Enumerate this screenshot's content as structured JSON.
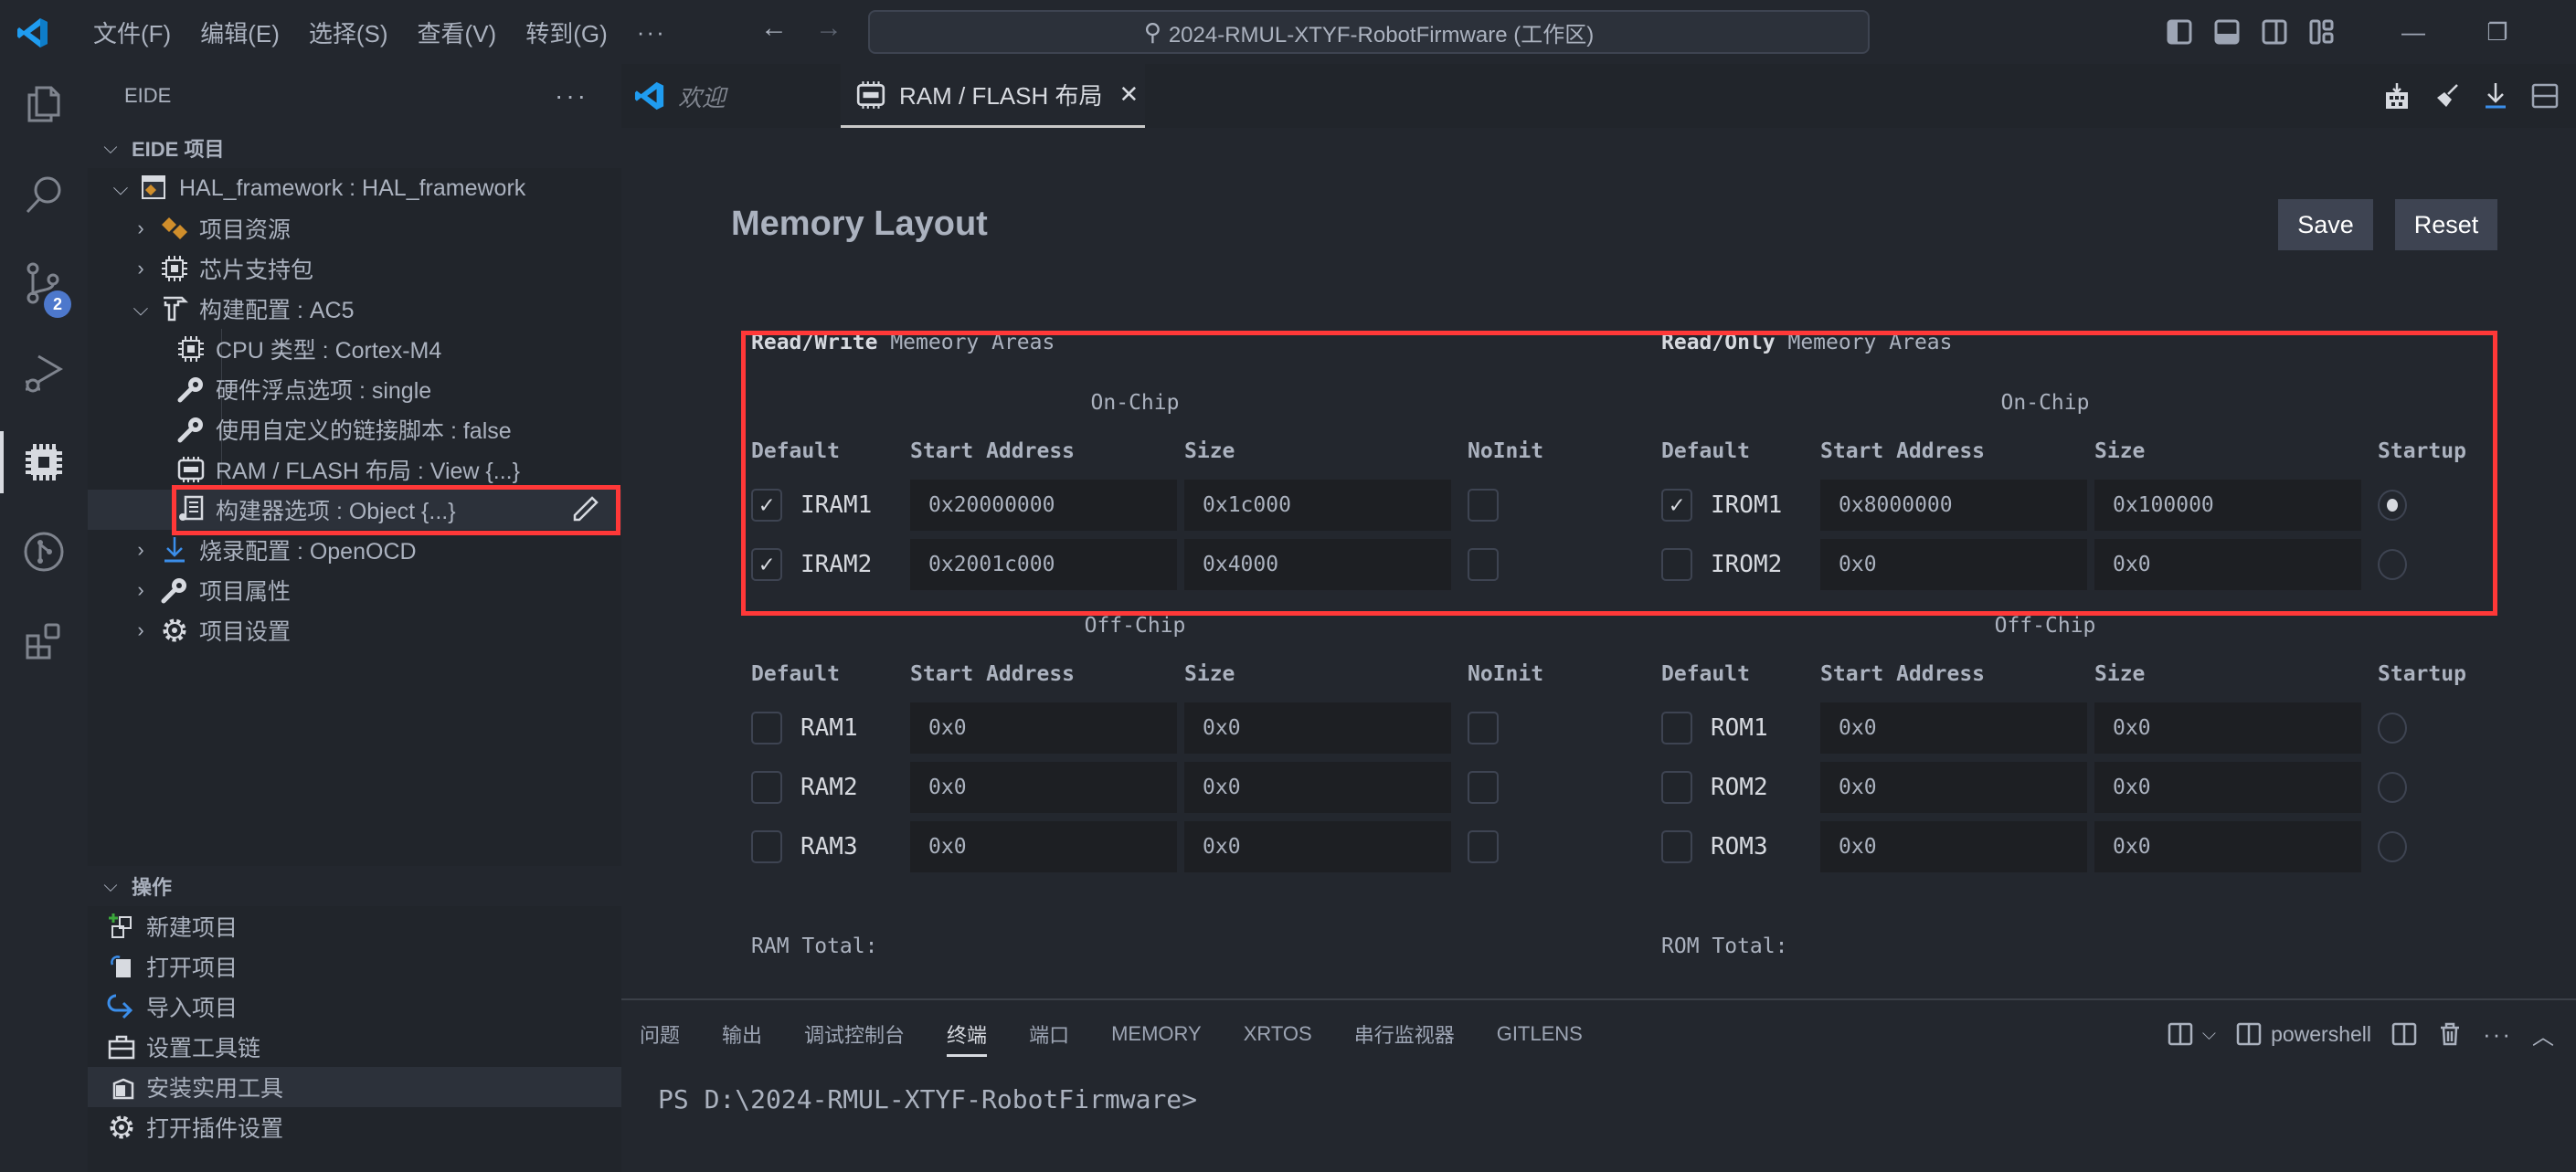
{
  "titlebar": {
    "menu": [
      "文件(F)",
      "编辑(E)",
      "选择(S)",
      "查看(V)",
      "转到(G)",
      "···"
    ],
    "command_center": "2024-RMUL-XTYF-RobotFirmware (工作区)",
    "icons": [
      "toggle-primary-sidebar-icon",
      "toggle-panel-icon",
      "toggle-secondary-sidebar-icon",
      "customize-layout-icon"
    ],
    "window_controls": {
      "minimize": "—",
      "restore": "❐"
    }
  },
  "activity_bar": {
    "items": [
      "explorer",
      "search",
      "source-control",
      "run-debug",
      "eide",
      "git-graph",
      "extensions"
    ],
    "source_control_badge": "2",
    "active": "eide"
  },
  "sidebar": {
    "title": "EIDE",
    "more": "···",
    "project_section": "EIDE 项目",
    "tree": [
      {
        "label": "HAL_framework : HAL_framework",
        "level": 0,
        "expanded": true,
        "icon": "project-icon"
      },
      {
        "label": "项目资源",
        "level": 1,
        "expanded": false,
        "icon": "resources-icon"
      },
      {
        "label": "芯片支持包",
        "level": 1,
        "expanded": false,
        "icon": "chip-icon"
      },
      {
        "label": "构建配置 : AC5",
        "level": 1,
        "expanded": true,
        "icon": "hammer-icon"
      },
      {
        "label": "CPU 类型 : Cortex-M4",
        "level": 2,
        "icon": "cpu-icon"
      },
      {
        "label": "硬件浮点选项 : single",
        "level": 2,
        "icon": "wrench-icon"
      },
      {
        "label": "使用自定义的链接脚本 : false",
        "level": 2,
        "icon": "wrench-icon"
      },
      {
        "label": "RAM / FLASH 布局 : View {...}",
        "level": 2,
        "icon": "memory-icon"
      },
      {
        "label": "构建器选项 : Object {...}",
        "level": 2,
        "icon": "builder-options-icon",
        "selected": true
      },
      {
        "label": "烧录配置 : OpenOCD",
        "level": 1,
        "expanded": false,
        "icon": "flash-download-icon"
      },
      {
        "label": "项目属性",
        "level": 1,
        "expanded": false,
        "icon": "wrench-icon"
      },
      {
        "label": "项目设置",
        "level": 1,
        "expanded": false,
        "icon": "gear-icon"
      }
    ],
    "ops_section": "操作",
    "ops": [
      {
        "label": "新建项目",
        "icon": "new-project-icon"
      },
      {
        "label": "打开项目",
        "icon": "open-project-icon"
      },
      {
        "label": "导入项目",
        "icon": "import-project-icon"
      },
      {
        "label": "设置工具链",
        "icon": "toolbox-icon"
      },
      {
        "label": "安装实用工具",
        "icon": "install-tool-icon",
        "selected": true
      },
      {
        "label": "打开插件设置",
        "icon": "gear-icon"
      }
    ]
  },
  "editor": {
    "tabs": [
      {
        "label": "欢迎",
        "active": false
      },
      {
        "label": "RAM / FLASH 布局",
        "active": true,
        "close": "✕"
      }
    ],
    "title": "Memory Layout",
    "save_label": "Save",
    "reset_label": "Reset",
    "rw": {
      "title_bold": "Read/Write",
      "title_rest": " Memeory Areas",
      "on_chip_title": "On-Chip",
      "off_chip_title": "Off-Chip",
      "columns": [
        "Default",
        "Start Address",
        "Size",
        "NoInit"
      ],
      "on_chip": [
        {
          "name": "IRAM1",
          "default": true,
          "start": "0x20000000",
          "size": "0x1c000",
          "noinit": false
        },
        {
          "name": "IRAM2",
          "default": true,
          "start": "0x2001c000",
          "size": "0x4000",
          "noinit": false
        }
      ],
      "off_chip": [
        {
          "name": "RAM1",
          "default": false,
          "start": "0x0",
          "size": "0x0",
          "noinit": false
        },
        {
          "name": "RAM2",
          "default": false,
          "start": "0x0",
          "size": "0x0",
          "noinit": false
        },
        {
          "name": "RAM3",
          "default": false,
          "start": "0x0",
          "size": "0x0",
          "noinit": false
        }
      ],
      "total_label": "RAM Total:"
    },
    "ro": {
      "title_bold": "Read/Only",
      "title_rest": " Memeory Areas",
      "on_chip_title": "On-Chip",
      "off_chip_title": "Off-Chip",
      "columns": [
        "Default",
        "Start Address",
        "Size",
        "Startup"
      ],
      "on_chip": [
        {
          "name": "IROM1",
          "default": true,
          "start": "0x8000000",
          "size": "0x100000",
          "startup": true
        },
        {
          "name": "IROM2",
          "default": false,
          "start": "0x0",
          "size": "0x0",
          "startup": false
        }
      ],
      "off_chip": [
        {
          "name": "ROM1",
          "default": false,
          "start": "0x0",
          "size": "0x0",
          "startup": false
        },
        {
          "name": "ROM2",
          "default": false,
          "start": "0x0",
          "size": "0x0",
          "startup": false
        },
        {
          "name": "ROM3",
          "default": false,
          "start": "0x0",
          "size": "0x0",
          "startup": false
        }
      ],
      "total_label": "ROM Total:"
    },
    "annotation_color": "#ff3838"
  },
  "panel": {
    "tabs": [
      "问题",
      "输出",
      "调试控制台",
      "终端",
      "端口",
      "MEMORY",
      "XRTOS",
      "串行监视器",
      "GITLENS"
    ],
    "active_tab": "终端",
    "terminal_name": "powershell",
    "prompt": "PS D:\\2024-RMUL-XTYF-RobotFirmware>"
  }
}
